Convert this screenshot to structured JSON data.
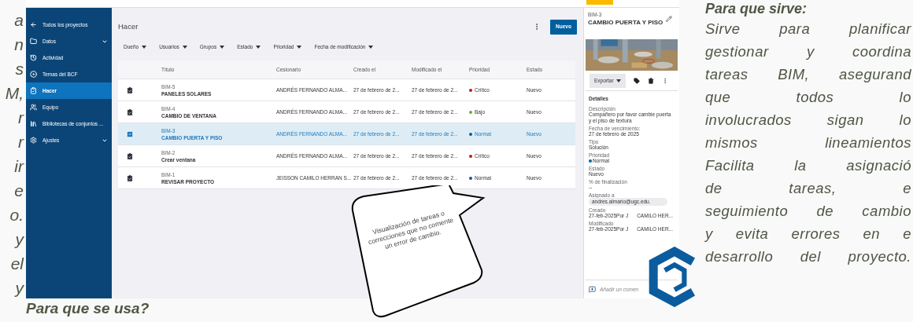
{
  "left_text_fragments": [
    "a",
    "n",
    "s",
    "M,",
    "r",
    "r",
    "ir",
    "e",
    "o.",
    "y",
    "el",
    "y"
  ],
  "bottom_heading": "Para que se usa?",
  "right_text": {
    "heading": "Para que sirve:",
    "lines": [
      "Sirve para planificar",
      "gestionar y coordina",
      "tareas BIM, asegurand",
      "que todos lo",
      "involucrados sigan lo",
      "mismos lineamientos",
      "Facilita la asignació",
      "de tareas, e",
      "seguimiento de cambio",
      "y evita errores en e",
      "desarrollo del proyecto."
    ]
  },
  "sidebar": {
    "items": [
      {
        "kind": "back",
        "label": "Todos los proyectos",
        "selected": false,
        "submenu": false
      },
      {
        "kind": "folder",
        "label": "Datos",
        "selected": false,
        "submenu": true
      },
      {
        "kind": "history",
        "label": "Actividad",
        "selected": false,
        "submenu": false
      },
      {
        "kind": "bcf",
        "label": "Temas del BCF",
        "selected": false,
        "submenu": false
      },
      {
        "kind": "todo",
        "label": "Hacer",
        "selected": true,
        "submenu": false
      },
      {
        "kind": "team",
        "label": "Equipo",
        "selected": false,
        "submenu": false
      },
      {
        "kind": "library",
        "label": "Bibliotecas de conjuntos ...",
        "selected": false,
        "submenu": false
      },
      {
        "kind": "settings",
        "label": "Ajustes",
        "selected": false,
        "submenu": true
      }
    ]
  },
  "main": {
    "title": "Hacer",
    "new_button": "Nuevo",
    "filters": [
      "Dueño",
      "Usuarios",
      "Grupos",
      "Estado",
      "Prioridad",
      "Fecha de modificación"
    ],
    "table": {
      "columns": [
        "Título",
        "Cesionario",
        "Creado el",
        "Modificado el",
        "Prioridad",
        "Estado"
      ],
      "rows": [
        {
          "id": "BIM-5",
          "title": "PANELES SOLARES",
          "assignee": "ANDRÉS FERNANDO ALMA...",
          "created": "27 de febrero de 2...",
          "modified": "27 de febrero de 2...",
          "priority": "Crítico",
          "color": "#d0121b",
          "status": "Nuevo",
          "selected": false
        },
        {
          "id": "BIM-4",
          "title": "CAMBIO DE VENTANA",
          "assignee": "ANDRÉS FERNANDO ALMA...",
          "created": "27 de febrero de 2...",
          "modified": "27 de febrero de 2...",
          "priority": "Bajo",
          "color": "#6aaa3a",
          "status": "Nuevo",
          "selected": false
        },
        {
          "id": "BIM-3",
          "title": "CAMBIO PUERTA Y PISO",
          "assignee": "ANDRÉS FERNANDO ALMA...",
          "created": "27 de febrero de 2...",
          "modified": "27 de febrero de 2...",
          "priority": "Normal",
          "color": "#005f9e",
          "status": "Nuevo",
          "selected": true
        },
        {
          "id": "BIM-2",
          "title": "Crear ventana",
          "assignee": "ANDRÉS FERNANDO ALMA...",
          "created": "27 de febrero de 2...",
          "modified": "27 de febrero de 2...",
          "priority": "Crítico",
          "color": "#d0121b",
          "status": "Nuevo",
          "selected": false
        },
        {
          "id": "BIM-1",
          "title": "REVISAR PROYECTO",
          "assignee": "JEISSON CAMILO HERRAN S...",
          "created": "27 de febrero de 2...",
          "modified": "27 de febrero de 2...",
          "priority": "Normal",
          "color": "#005f9e",
          "status": "Nuevo",
          "selected": false
        }
      ]
    }
  },
  "detail": {
    "id": "BIM-3",
    "title": "CAMBIO PUERTA Y PISO",
    "export_button": "Exportar",
    "section": "Detalles",
    "fields": [
      {
        "kind": "text",
        "label": "Descripción",
        "value": "Compañero por favor cambie puerta y el piso de textura"
      },
      {
        "kind": "text",
        "label": "Fecha de vencimiento:",
        "value": "27 de febrero de 2025"
      },
      {
        "kind": "text",
        "label": "Tipo",
        "value": "Solución"
      },
      {
        "kind": "priority",
        "label": "Prioridad",
        "value": "Normal",
        "color": "#005f9e"
      },
      {
        "kind": "text",
        "label": "Estado",
        "value": "Nuevo"
      },
      {
        "kind": "text",
        "label": "% de finalización",
        "value": "--"
      },
      {
        "kind": "chip",
        "label": "Asignado a",
        "value": "andres.almario@ugc.edu."
      },
      {
        "kind": "split",
        "label": "Creado",
        "value": "27-feb-2025Por J",
        "tail": "CAMILO HER..."
      },
      {
        "kind": "split",
        "label": "Modificado",
        "value": "27-feb-2025Por J",
        "tail": "CAMILO HER..."
      }
    ],
    "comment": {
      "placeholder": "Añadir un comen"
    }
  },
  "callout": {
    "text": "Visualización de tareas o correcciones que no comente un error de cambio."
  }
}
